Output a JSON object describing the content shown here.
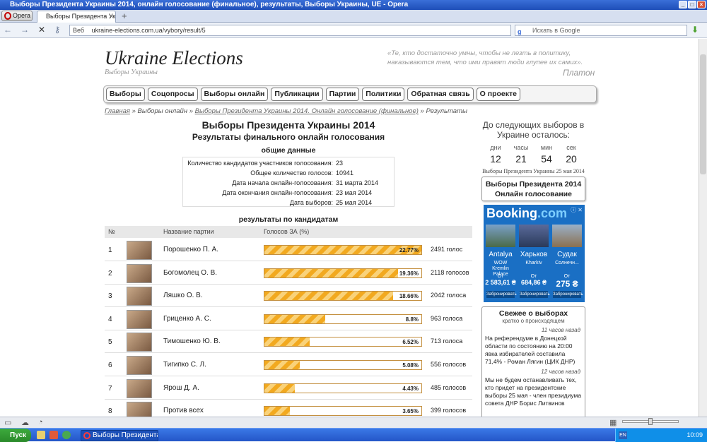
{
  "window": {
    "title": "Выборы Президента Украины 2014, онлайн голосование (финальное), результаты, Выборы Украины, UE - Opera"
  },
  "browser": {
    "opera_label": "Opera",
    "tab_title": "Выборы Президента Ук...",
    "url_label": "Веб",
    "url": "ukraine-elections.com.ua/vybory/result/5",
    "search_placeholder": "Искать в Google"
  },
  "site": {
    "logo": "Ukraine Elections",
    "logo_sub": "Выборы Украины",
    "quote": "«Те, кто достаточно умны, чтобы не лезть в политику, наказываются тем, что ими правят люди глупее их самих».",
    "quote_author": "Платон"
  },
  "nav": [
    "Выборы",
    "Соцопросы",
    "Выборы онлайн",
    "Публикации",
    "Партии",
    "Политики",
    "Обратная связь",
    "О проекте"
  ],
  "breadcrumb": {
    "home": "Главная",
    "sep": "»",
    "online": "Выборы онлайн",
    "vote": "Выборы Президента Украины 2014. Онлайн голосование (финальное)",
    "current": "Результаты"
  },
  "main": {
    "title": "Выборы Президента Украины 2014",
    "subtitle": "Результаты финального онлайн голосования",
    "general_heading": "общие данные",
    "general": [
      {
        "k": "Количество кандидатов участников голосования:",
        "v": "23"
      },
      {
        "k": "Общее количество голосов:",
        "v": "10941"
      },
      {
        "k": "Дата начала онлайн-голосования:",
        "v": "31 марта 2014"
      },
      {
        "k": "Дата окончания онлайн-голосования:",
        "v": "23 мая 2014"
      },
      {
        "k": "Дата выборов:",
        "v": "25 мая 2014"
      }
    ],
    "candidates_heading": "результаты по кандидатам",
    "table_headers": {
      "num": "№",
      "party": "Название партии",
      "votes": "Голосов ЗА (%)"
    },
    "rows": [
      {
        "num": "1",
        "name": "Порошенко П. А.",
        "pct": "22.77%",
        "fraction": 0.2277,
        "votes": "2491 голос"
      },
      {
        "num": "2",
        "name": "Богомолец О. В.",
        "pct": "19.36%",
        "fraction": 0.1936,
        "votes": "2118 голосов"
      },
      {
        "num": "3",
        "name": "Ляшко О. В.",
        "pct": "18.66%",
        "fraction": 0.1866,
        "votes": "2042 голоса"
      },
      {
        "num": "4",
        "name": "Гриценко А. С.",
        "pct": "8.8%",
        "fraction": 0.088,
        "votes": "963 голоса"
      },
      {
        "num": "5",
        "name": "Тимошенко Ю. В.",
        "pct": "6.52%",
        "fraction": 0.0652,
        "votes": "713 голоса"
      },
      {
        "num": "6",
        "name": "Тигипко С. Л.",
        "pct": "5.08%",
        "fraction": 0.0508,
        "votes": "556 голосов"
      },
      {
        "num": "7",
        "name": "Ярош Д. А.",
        "pct": "4.43%",
        "fraction": 0.0443,
        "votes": "485 голосов"
      },
      {
        "num": "8",
        "name": "Против всех",
        "pct": "3.65%",
        "fraction": 0.0365,
        "votes": "399 голосов"
      }
    ]
  },
  "sidebar": {
    "countdown_heading": "До следующих выборов в Украине осталось:",
    "countdown": [
      {
        "unit": "дни",
        "value": "12"
      },
      {
        "unit": "часы",
        "value": "21"
      },
      {
        "unit": "мин",
        "value": "54"
      },
      {
        "unit": "сек",
        "value": "20"
      }
    ],
    "countdown_note": "Выборы Президента Украины 25 мая 2014",
    "vote_box": "Выборы Президента 2014 Онлайн голосование",
    "ad": {
      "brand_a": "Booking",
      "brand_b": ".com",
      "close": "ⓘ ✕",
      "offers": [
        {
          "city": "Antalya",
          "hotel": "WOW Kremlin Palace",
          "price": "2 583,61 ₴",
          "btn": "Забронировать"
        },
        {
          "city": "Харьков",
          "hotel": "Kharkiv",
          "price": "684,86 ₴",
          "btn": "Забронировать"
        },
        {
          "city": "Судак",
          "hotel": "Солнечн...",
          "price": "275 ₴",
          "btn": "Забронировать"
        }
      ],
      "price_prefix": "От"
    },
    "news_heading": "Свежее о выборах",
    "news_sub": "кратко о происходящем",
    "news": [
      {
        "time": "11 часов назад",
        "text": "На референдуме в Донецкой области по состоянию на 20:00 явка избирателей составила 71,4% - Роман Лягин (ЦИК ДНР)"
      },
      {
        "time": "12 часов назад",
        "text": "Мы не будем останавливать тех, кто придет на президентские выборы 25 мая - член президиума совета ДНР Борис Литвинов"
      }
    ]
  },
  "taskbar": {
    "start": "Пуск",
    "task_item": "Выборы Президента...",
    "lang": "EN",
    "clock": "10:09"
  }
}
